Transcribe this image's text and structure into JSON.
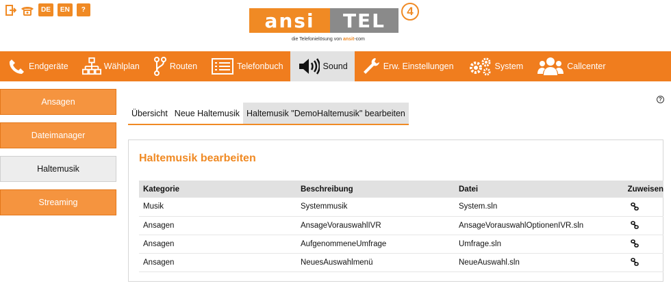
{
  "header": {
    "utility": {
      "logout_icon": "logout-icon",
      "phone_icon": "phone-icon",
      "lang_de": "DE",
      "lang_en": "EN",
      "help": "?"
    },
    "logo": {
      "left": "ansi",
      "right": "TEL",
      "badge": "4",
      "tagline_prefix": "die Telefonielösung von ",
      "tagline_brand": "ansit",
      "tagline_suffix": "-com"
    }
  },
  "nav": {
    "items": [
      {
        "label": "Endgeräte",
        "icon": "phone-handset-icon"
      },
      {
        "label": "Wählplan",
        "icon": "sitemap-icon"
      },
      {
        "label": "Routen",
        "icon": "route-icon"
      },
      {
        "label": "Telefonbuch",
        "icon": "list-icon"
      },
      {
        "label": "Sound",
        "icon": "speaker-icon"
      },
      {
        "label": "Erw. Einstellungen",
        "icon": "wrench-icon"
      },
      {
        "label": "System",
        "icon": "gears-icon"
      },
      {
        "label": "Callcenter",
        "icon": "users-icon"
      }
    ],
    "active": "Sound"
  },
  "sidebar": {
    "items": [
      {
        "label": "Ansagen"
      },
      {
        "label": "Dateimanager"
      },
      {
        "label": "Haltemusik"
      },
      {
        "label": "Streaming"
      }
    ],
    "active": "Haltemusik"
  },
  "help_icon": "?",
  "breadcrumb": {
    "items": [
      {
        "label": "Übersicht"
      },
      {
        "label": "Neue Haltemusik"
      },
      {
        "label": "Haltemusik \"DemoHaltemusik\" bearbeiten"
      }
    ]
  },
  "panel": {
    "title": "Haltemusik bearbeiten",
    "columns": [
      "Kategorie",
      "Beschreibung",
      "Datei",
      "Zuweisen"
    ],
    "rows": [
      {
        "kategorie": "Musik",
        "beschreibung": "Systemmusik",
        "datei": "System.sln"
      },
      {
        "kategorie": "Ansagen",
        "beschreibung": "AnsageVorauswahlIVR",
        "datei": "AnsageVorauswahlOptionenIVR.sln"
      },
      {
        "kategorie": "Ansagen",
        "beschreibung": "AufgenommeneUmfrage",
        "datei": "Umfrage.sln"
      },
      {
        "kategorie": "Ansagen",
        "beschreibung": "NeuesAuswahlmenü",
        "datei": "NeueAuswahl.sln"
      }
    ]
  },
  "colors": {
    "accent": "#f08a24",
    "nav_bg": "#f07d1e",
    "active_bg": "#e2e2e2"
  }
}
